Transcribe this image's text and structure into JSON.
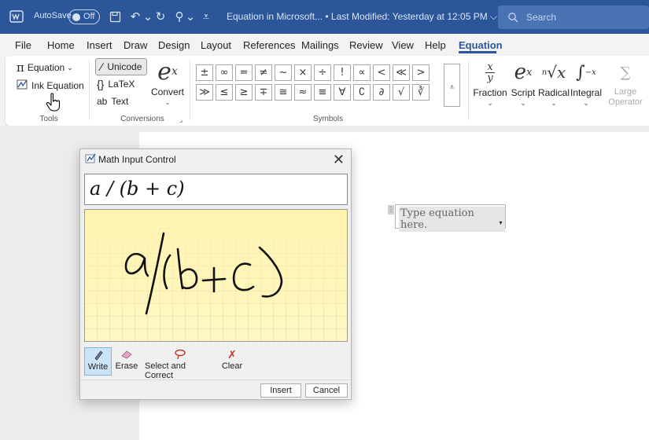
{
  "titlebar": {
    "autosave_label": "AutoSave",
    "autosave_state": "Off",
    "document_title": "Equation in Microsoft... • Last Modified: Yesterday at 12:05 PM ⌵",
    "search_placeholder": "Search"
  },
  "tabs": [
    "File",
    "Home",
    "Insert",
    "Draw",
    "Design",
    "Layout",
    "References",
    "Mailings",
    "Review",
    "View",
    "Help",
    "Equation"
  ],
  "active_tab": "Equation",
  "ribbon": {
    "tools": {
      "equation_label": "Equation",
      "ink_equation_label": "Ink Equation",
      "group_label": "Tools"
    },
    "conversions": {
      "unicode_label": "Unicode",
      "latex_label": "LaTeX",
      "text_label": "Text",
      "convert_label": "Convert",
      "group_label": "Conversions"
    },
    "symbols": {
      "row1": [
        "±",
        "∞",
        "=",
        "≠",
        "~",
        "×",
        "÷",
        "!",
        "∝",
        "<",
        "≪",
        ">"
      ],
      "row2": [
        "≫",
        "≤",
        "≥",
        "∓",
        "≅",
        "≈",
        "≡",
        "∀",
        "∁",
        "∂",
        "√",
        "∛"
      ],
      "group_label": "Symbols"
    },
    "structures": [
      {
        "label": "Fraction",
        "disabled": false
      },
      {
        "label": "Script",
        "disabled": false
      },
      {
        "label": "Radical",
        "disabled": false
      },
      {
        "label": "Integral",
        "disabled": false
      },
      {
        "label": "Large Operator",
        "disabled": true
      }
    ]
  },
  "document": {
    "equation_placeholder": "Type equation here."
  },
  "dialog": {
    "title": "Math Input Control",
    "recognized_expression": "a / (b + c)",
    "tools": [
      "Write",
      "Erase",
      "Select and Correct",
      "Clear"
    ],
    "active_tool": "Write",
    "insert_label": "Insert",
    "cancel_label": "Cancel"
  },
  "colors": {
    "titlebar": "#2b579a",
    "accent": "#2b579a",
    "canvas": "#fff8c4"
  }
}
